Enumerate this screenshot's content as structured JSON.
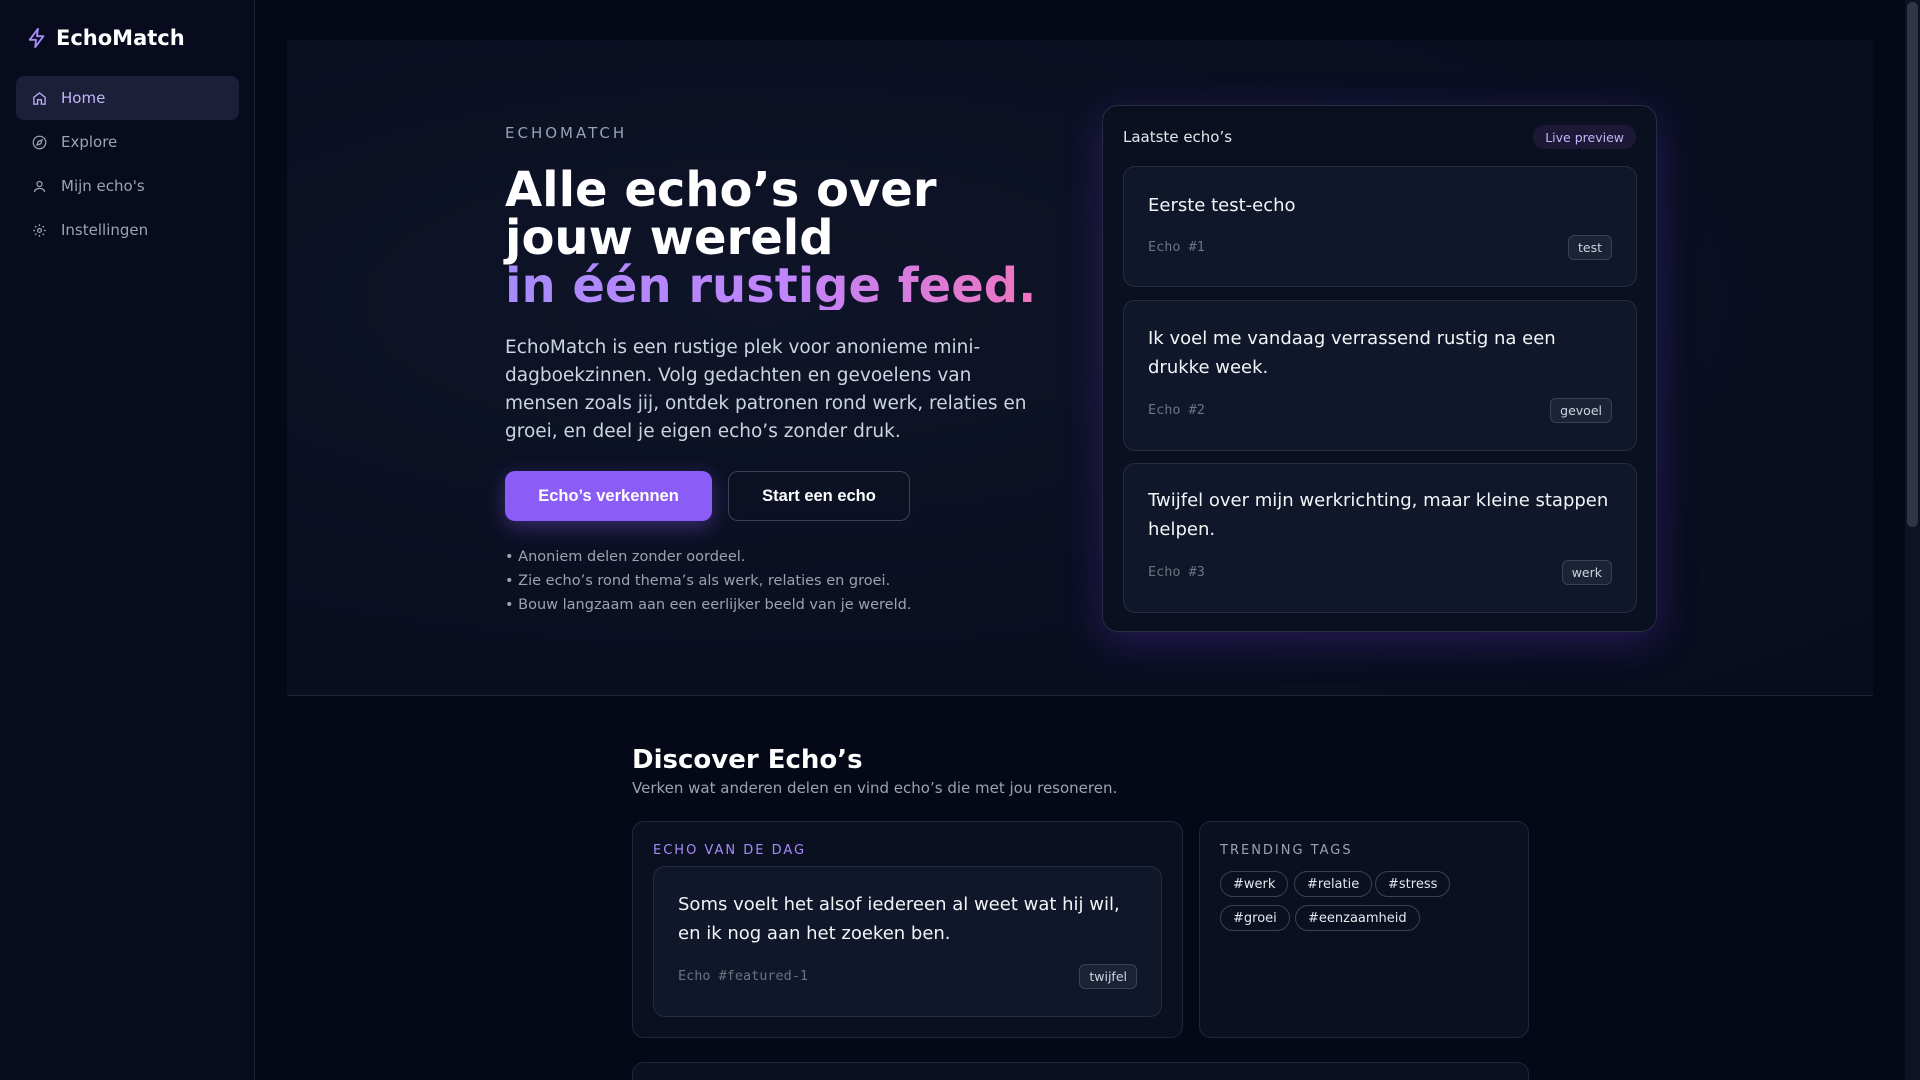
{
  "app": {
    "name": "EchoMatch"
  },
  "sidebar": {
    "items": [
      {
        "label": "Home",
        "icon": "home-icon",
        "active": true
      },
      {
        "label": "Explore",
        "icon": "compass-icon",
        "active": false
      },
      {
        "label": "Mijn echo's",
        "icon": "user-icon",
        "active": false
      },
      {
        "label": "Instellingen",
        "icon": "gear-icon",
        "active": false
      }
    ]
  },
  "hero": {
    "eyebrow": "ECHOMATCH",
    "headline_line1": "Alle echo’s over jouw wereld",
    "headline_line2": "in één rustige feed.",
    "lead": "EchoMatch is een rustige plek voor anonieme mini-dagboekzinnen. Volg gedachten en gevoelens van mensen zoals jij, ontdek patronen rond werk, relaties en groei, en deel je eigen echo’s zonder druk.",
    "primary_button": "Echo’s verkennen",
    "secondary_button": "Start een echo",
    "bullets": [
      "• Anoniem delen zonder oordeel.",
      "• Zie echo’s rond thema’s als werk, relaties en groei.",
      "• Bouw langzaam aan een eerlijker beeld van je wereld."
    ]
  },
  "preview": {
    "title": "Laatste echo’s",
    "badge": "Live preview",
    "echos": [
      {
        "text": "Eerste test-echo",
        "id": "Echo #1",
        "tag": "test"
      },
      {
        "text": "Ik voel me vandaag verrassend rustig na een drukke week.",
        "id": "Echo #2",
        "tag": "gevoel"
      },
      {
        "text": "Twijfel over mijn werkrichting, maar kleine stappen helpen.",
        "id": "Echo #3",
        "tag": "werk"
      }
    ]
  },
  "discover": {
    "title": "Discover Echo’s",
    "subtitle": "Verken wat anderen delen en vind echo’s die met jou resoneren.",
    "echo_of_day": {
      "label": "ECHO VAN DE DAG",
      "text": "Soms voelt het alsof iedereen al weet wat hij wil, en ik nog aan het zoeken ben.",
      "id": "Echo #featured-1",
      "tag": "twijfel"
    },
    "trending": {
      "label": "TRENDING TAGS",
      "tags": [
        "#werk",
        "#relatie",
        "#stress",
        "#groei",
        "#eenzaamheid"
      ]
    }
  },
  "colors": {
    "accent": "#8b5cf6",
    "background": "#050816",
    "gradient_start": "#a78bfa",
    "gradient_end": "#f472b6"
  }
}
